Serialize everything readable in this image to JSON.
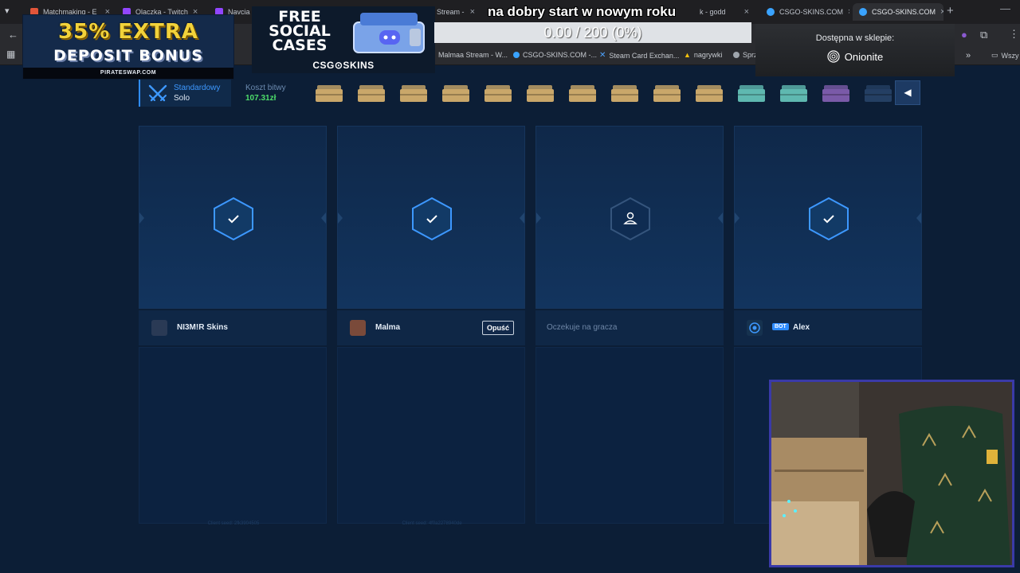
{
  "browser": {
    "tabs": [
      {
        "label": "Matchmaking - E",
        "color": "#e2553a"
      },
      {
        "label": "Olaczka - Twitch",
        "color": "#9146ff"
      },
      {
        "label": "Navcia",
        "color": "#9146ff"
      },
      {
        "label": "Stream -",
        "color": "#3aa3ff"
      },
      {
        "label": "k - godd",
        "color": "#3aa3ff"
      },
      {
        "label": "CSGO-SKINS.COM",
        "color": "#3aa3ff"
      },
      {
        "label": "CSGO-SKINS.COM",
        "color": "#3aa3ff"
      }
    ],
    "bookmarks": [
      {
        "label": "Malmaa Stream - W..."
      },
      {
        "label": "CSGO-SKINS.COM -..."
      },
      {
        "label": "Steam Card Exchan..."
      },
      {
        "label": "nagrywki"
      },
      {
        "label": "Sprz"
      },
      {
        "label": "Wszy"
      }
    ]
  },
  "overlay": {
    "ad": {
      "line1": "35% EXTRA",
      "line2": "DEPOSIT BONUS",
      "footer": "PIRATESWAP.COM"
    },
    "promo": {
      "line1": "FREE",
      "line2": "SOCIAL",
      "line3": "CASES",
      "brand": "CSG⊙SKINS"
    },
    "message": "na dobry start w nowym roku",
    "progress": {
      "text": "0.00 / 200 (0%)",
      "fraction": 0
    },
    "shop": {
      "label": "Dostępna w sklepie:",
      "brand": "Onionite"
    }
  },
  "battle": {
    "mode_name": "Standardowy",
    "mode_sub": "Solo",
    "cost_label": "Koszt bitwy",
    "cost_value": "107.31zł",
    "cases": [
      {
        "color": "#c9a76a"
      },
      {
        "color": "#c9a76a"
      },
      {
        "color": "#c9a76a"
      },
      {
        "color": "#c9a76a"
      },
      {
        "color": "#c9a76a"
      },
      {
        "color": "#c9a76a"
      },
      {
        "color": "#c9a76a"
      },
      {
        "color": "#c9a76a"
      },
      {
        "color": "#c9a76a"
      },
      {
        "color": "#c9a76a"
      },
      {
        "color": "#5fb8b0"
      },
      {
        "color": "#5fb8b0"
      },
      {
        "color": "#7a5aa8"
      },
      {
        "color": "#243f63"
      }
    ],
    "players": [
      {
        "name": "NI3M!R Skins",
        "status": "ready",
        "avatar_color": "#2a3a55",
        "seed": "Client seed: 2fk3904505"
      },
      {
        "name": "Malma",
        "status": "ready",
        "avatar_color": "#7a4a3a",
        "leave_label": "Opuść",
        "seed": "Client seed: 4f0a2278940de"
      },
      {
        "name": "",
        "status": "waiting",
        "wait_label": "Oczekuje na gracza",
        "seed": ""
      },
      {
        "name": "Alex",
        "status": "ready",
        "bot_label": "BOT",
        "avatar_color": "#16324f",
        "seed": ""
      }
    ]
  }
}
